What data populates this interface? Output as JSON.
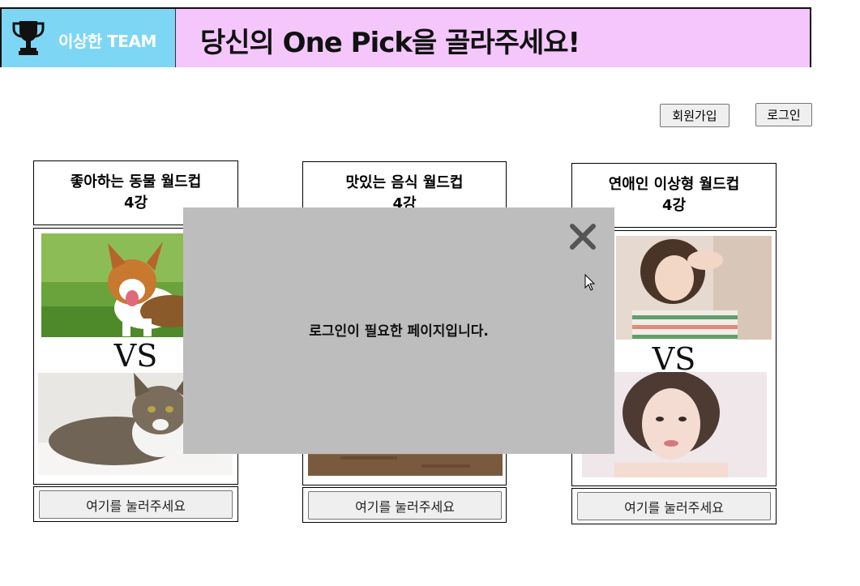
{
  "header": {
    "logo_text": "이상한 TEAM",
    "title": "당신의 One Pick을 골라주세요!",
    "logo_color": "#7ed6f5",
    "title_bg": "#f4c6fb"
  },
  "auth": {
    "signup_label": "회원가입",
    "login_label": "로그인"
  },
  "cards": [
    {
      "title_line1": "좋아하는 동물 월드컵",
      "title_line2": "4강",
      "vs": "VS",
      "button_label": "여기를 눌러주세요"
    },
    {
      "title_line1": "맛있는 음식 월드컵",
      "title_line2": "4강",
      "button_label": "여기를 눌러주세요"
    },
    {
      "title_line1": "연애인 이상형 월드컵",
      "title_line2": "4강",
      "vs": "VS",
      "button_label": "여기를 눌러주세요"
    }
  ],
  "modal": {
    "message": "로그인이 필요한 페이지입니다."
  }
}
